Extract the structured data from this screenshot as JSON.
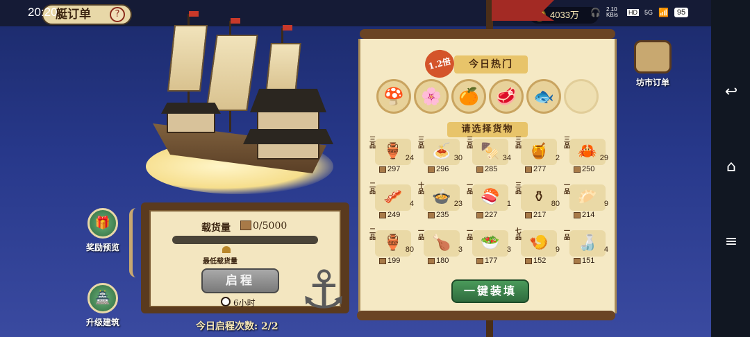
{
  "status_bar": {
    "time": "20:20",
    "coins": "4033万",
    "network_speed": "2.10 KB/s",
    "network_type": "5G",
    "battery": "95",
    "corner_id": "1276388"
  },
  "header": {
    "title": "艇订单",
    "help_icon": "?"
  },
  "left_board": {
    "capacity_label": "载货量",
    "capacity_value": "0/5000",
    "min_capacity_label": "最低载货量",
    "depart_button": "启程",
    "duration": "6小时",
    "trips_today": "今日启程次数: 2/2"
  },
  "side_buttons": {
    "rewards_preview": "奖励预览",
    "upgrade_building": "升级建筑",
    "market_orders": "坊市订单"
  },
  "panel": {
    "hot_badge": "1.2倍",
    "hot_title": "今日热门",
    "hot_items": [
      {
        "icon": "mushroom-icon",
        "glyph": "🍄"
      },
      {
        "icon": "flower-icon",
        "glyph": "🌸"
      },
      {
        "icon": "orange-icon",
        "glyph": "🍊"
      },
      {
        "icon": "salmon-icon",
        "glyph": "🥩"
      },
      {
        "icon": "fish-dish-icon",
        "glyph": "🐟"
      },
      {
        "icon": "empty-slot",
        "glyph": ""
      }
    ],
    "choose_title": "请选择货物",
    "fill_button": "一键装填"
  },
  "goods": [
    {
      "tier": "三品",
      "icon": "gourd-icon",
      "glyph": "🏺",
      "stock": "24",
      "price": "297"
    },
    {
      "tier": "三品",
      "icon": "noodle-plate-icon",
      "glyph": "🍝",
      "stock": "30",
      "price": "296"
    },
    {
      "tier": "三品",
      "icon": "skewer-icon",
      "glyph": "🍢",
      "stock": "34",
      "price": "285"
    },
    {
      "tier": "三品",
      "icon": "tea-box-icon",
      "glyph": "🍯",
      "stock": "2",
      "price": "277"
    },
    {
      "tier": "三品",
      "icon": "crab-dish-icon",
      "glyph": "🦀",
      "stock": "29",
      "price": "250"
    },
    {
      "tier": "二品",
      "icon": "meat-tray-icon",
      "glyph": "🥓",
      "stock": "4",
      "price": "249"
    },
    {
      "tier": "十品",
      "icon": "feast-plate-icon",
      "glyph": "🍲",
      "stock": "23",
      "price": "235"
    },
    {
      "tier": "一品",
      "icon": "fish-tray-icon",
      "glyph": "🍣",
      "stock": "1",
      "price": "227"
    },
    {
      "tier": "三品",
      "icon": "jar-icon",
      "glyph": "⚱",
      "stock": "80",
      "price": "217"
    },
    {
      "tier": "一品",
      "icon": "pastry-plate-icon",
      "glyph": "🥟",
      "stock": "9",
      "price": "214"
    },
    {
      "tier": "二品",
      "icon": "vase-icon",
      "glyph": "🏺",
      "stock": "80",
      "price": "199"
    },
    {
      "tier": "一品",
      "icon": "roast-box-icon",
      "glyph": "🍗",
      "stock": "3",
      "price": "180"
    },
    {
      "tier": "一品",
      "icon": "greens-bowl-icon",
      "glyph": "🥗",
      "stock": "3",
      "price": "177"
    },
    {
      "tier": "七品",
      "icon": "grill-plate-icon",
      "glyph": "🍤",
      "stock": "9",
      "price": "152"
    },
    {
      "tier": "一品",
      "icon": "gourd-bottle-icon",
      "glyph": "🍶",
      "stock": "4",
      "price": "151"
    }
  ],
  "colors": {
    "background": "#27388a",
    "scroll": "#f5e9c4",
    "wood": "#6a4424",
    "green_button": "#2f6c3e",
    "banner_red": "#a32a24"
  }
}
